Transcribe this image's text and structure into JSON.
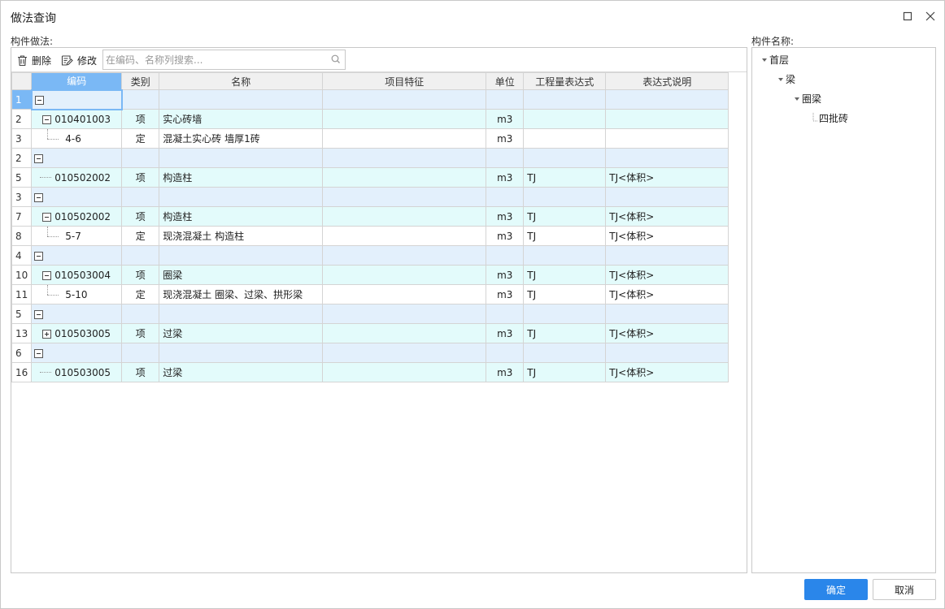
{
  "window": {
    "title": "做法查询"
  },
  "left": {
    "label": "构件做法:",
    "toolbar": {
      "delete_label": "删除",
      "edit_label": "修改",
      "search_placeholder": "在编码、名称列搜索..."
    },
    "columns": [
      "编码",
      "类别",
      "名称",
      "项目特征",
      "单位",
      "工程量表达式",
      "表达式说明"
    ],
    "rows": [
      {
        "rn": "1",
        "kind": "group",
        "code": "",
        "type": "",
        "name": "",
        "feature": "",
        "unit": "",
        "expr": "",
        "desc": ""
      },
      {
        "rn": "2",
        "kind": "item",
        "code": "010401003",
        "type": "项",
        "name": "实心砖墙",
        "feature": "",
        "unit": "m3",
        "expr": "",
        "desc": ""
      },
      {
        "rn": "3",
        "kind": "quota",
        "code": "4-6",
        "type": "定",
        "name": "混凝土实心砖 墙厚1砖",
        "feature": "",
        "unit": "m3",
        "expr": "",
        "desc": ""
      },
      {
        "rn": "2",
        "kind": "group",
        "code": "",
        "type": "",
        "name": "",
        "feature": "",
        "unit": "",
        "expr": "",
        "desc": ""
      },
      {
        "rn": "5",
        "kind": "item-leaf",
        "code": "010502002",
        "type": "项",
        "name": "构造柱",
        "feature": "",
        "unit": "m3",
        "expr": "TJ",
        "desc": "TJ<体积>"
      },
      {
        "rn": "3",
        "kind": "group",
        "code": "",
        "type": "",
        "name": "",
        "feature": "",
        "unit": "",
        "expr": "",
        "desc": ""
      },
      {
        "rn": "7",
        "kind": "item",
        "code": "010502002",
        "type": "项",
        "name": "构造柱",
        "feature": "",
        "unit": "m3",
        "expr": "TJ",
        "desc": "TJ<体积>"
      },
      {
        "rn": "8",
        "kind": "quota",
        "code": "5-7",
        "type": "定",
        "name": "现浇混凝土 构造柱",
        "feature": "",
        "unit": "m3",
        "expr": "TJ",
        "desc": "TJ<体积>"
      },
      {
        "rn": "4",
        "kind": "group",
        "code": "",
        "type": "",
        "name": "",
        "feature": "",
        "unit": "",
        "expr": "",
        "desc": ""
      },
      {
        "rn": "10",
        "kind": "item",
        "code": "010503004",
        "type": "项",
        "name": "圈梁",
        "feature": "",
        "unit": "m3",
        "expr": "TJ",
        "desc": "TJ<体积>"
      },
      {
        "rn": "11",
        "kind": "quota",
        "code": "5-10",
        "type": "定",
        "name": "现浇混凝土 圈梁、过梁、拱形梁",
        "feature": "",
        "unit": "m3",
        "expr": "TJ",
        "desc": "TJ<体积>"
      },
      {
        "rn": "5",
        "kind": "group",
        "code": "",
        "type": "",
        "name": "",
        "feature": "",
        "unit": "",
        "expr": "",
        "desc": ""
      },
      {
        "rn": "13",
        "kind": "item-collapsed",
        "code": "010503005",
        "type": "项",
        "name": "过梁",
        "feature": "",
        "unit": "m3",
        "expr": "TJ",
        "desc": "TJ<体积>"
      },
      {
        "rn": "6",
        "kind": "group",
        "code": "",
        "type": "",
        "name": "",
        "feature": "",
        "unit": "",
        "expr": "",
        "desc": ""
      },
      {
        "rn": "16",
        "kind": "item-leaf",
        "code": "010503005",
        "type": "项",
        "name": "过梁",
        "feature": "",
        "unit": "m3",
        "expr": "TJ",
        "desc": "TJ<体积>"
      }
    ]
  },
  "right": {
    "label": "构件名称:",
    "tree": [
      {
        "label": "首层",
        "level": 0,
        "expanded": true
      },
      {
        "label": "梁",
        "level": 1,
        "expanded": true
      },
      {
        "label": "圈梁",
        "level": 2,
        "expanded": true
      },
      {
        "label": "四批砖",
        "level": 3,
        "expanded": false
      }
    ]
  },
  "footer": {
    "ok_label": "确定",
    "cancel_label": "取消"
  },
  "colors": {
    "accent": "#2a86ea",
    "header_selected": "#7ab8f5",
    "group_row": "#e3f0fc",
    "item_row": "#e3fbfb"
  }
}
